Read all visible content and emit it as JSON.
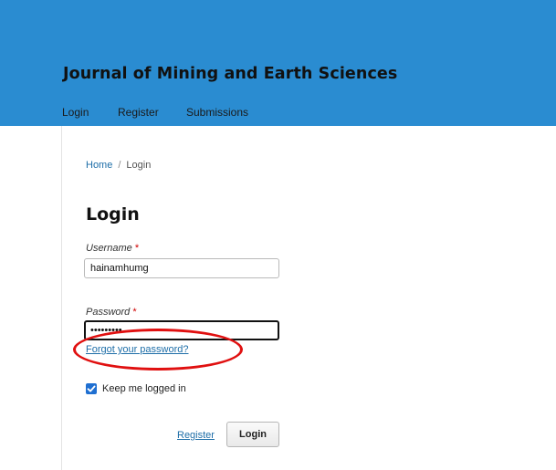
{
  "header": {
    "journal_title": "Journal of Mining and Earth Sciences",
    "nav": [
      {
        "label": "Login"
      },
      {
        "label": "Register"
      },
      {
        "label": "Submissions"
      }
    ],
    "background_color": "#2a8cd1"
  },
  "breadcrumb": {
    "home": "Home",
    "separator": "/",
    "current": "Login"
  },
  "page_title": "Login",
  "form": {
    "username": {
      "label": "Username",
      "required_mark": "*",
      "value": "hainamhumg"
    },
    "password": {
      "label": "Password",
      "required_mark": "*",
      "value": "•••••••••"
    },
    "forgot_password_link": "Forgot your password?",
    "keep_logged_in": {
      "label": "Keep me logged in",
      "checked": true
    },
    "register_link": "Register",
    "login_button": "Login"
  },
  "annotation": {
    "ring_color": "#e01010"
  }
}
